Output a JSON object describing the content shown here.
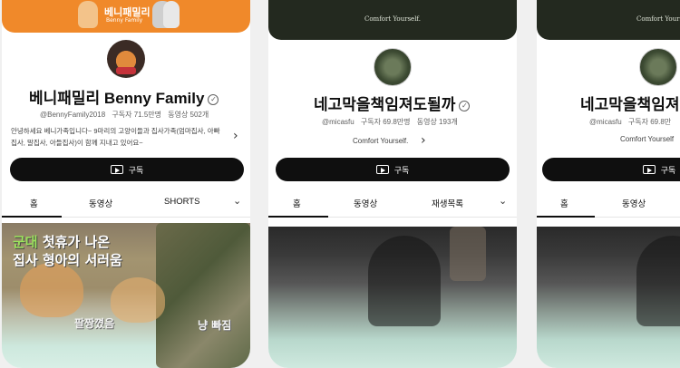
{
  "cards": [
    {
      "banner_title": "베니패밀리",
      "banner_sub": "Benny Family",
      "channel_name": "베니패밀리 Benny Family",
      "handle": "@BennyFamily2018",
      "subscribers": "구독자 71.5만명",
      "videos": "동영상 502개",
      "description": "안녕하세요 베니가족입니다~ 9마리의 고양이들과 집사가족(엄마집사, 아빠집사, 말집사, 아들집사)이 함께 지내고 있어요~",
      "subscribe_label": "구독",
      "tabs": [
        "홈",
        "동영상",
        "SHORTS"
      ],
      "thumb_caption_1a": "군대",
      "thumb_caption_1b": " 첫휴가 나온",
      "thumb_caption_2": "집사 형아의 서러움",
      "thumb_caption_3": "팔짱꼈음",
      "thumb_caption_4": "냥 빠짐"
    },
    {
      "banner_text": "Comfort Yourself.",
      "channel_name": "네고막을책임져도될까",
      "handle": "@micasfu",
      "subscribers": "구독자 69.8만명",
      "videos": "동영상 193개",
      "short_desc": "Comfort Yourself.",
      "subscribe_label": "구독",
      "tabs": [
        "홈",
        "동영상",
        "재생목록"
      ]
    },
    {
      "banner_text": "Comfort Yourself.",
      "channel_name": "네고막을책임져",
      "handle": "@micasfu",
      "subscribers": "구독자 69.8만",
      "short_desc": "Comfort Yourself",
      "subscribe_label": "구독",
      "tabs": [
        "홈",
        "동영상"
      ]
    }
  ],
  "icons": {
    "verified": "check-circle-icon",
    "chevron_right": "chevron-right-icon",
    "chevron_down": "chevron-down-icon",
    "subscribe": "youtube-play-icon"
  }
}
